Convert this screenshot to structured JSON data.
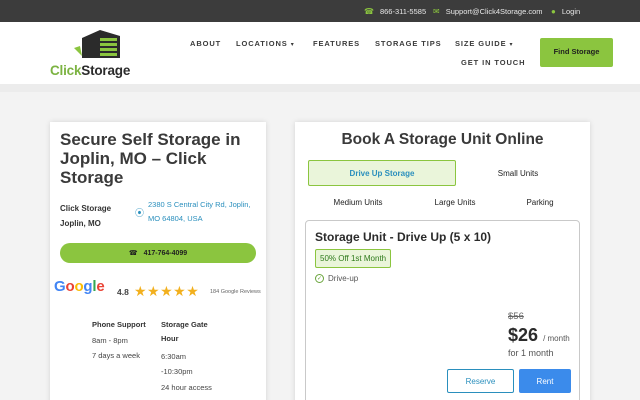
{
  "topbar": {
    "phone": "866-311-5585",
    "email": "Support@Click4Storage.com",
    "login": "Login",
    "phone_icon": "phone-icon",
    "email_icon": "envelope-icon",
    "login_icon": "user-icon"
  },
  "header": {
    "logo_word_1": "Click",
    "logo_word_2": "Storage",
    "nav": [
      {
        "label": "ABOUT"
      },
      {
        "label": "LOCATIONS",
        "caret": "▾"
      },
      {
        "label": "FEATURES"
      },
      {
        "label": "STORAGE TIPS"
      },
      {
        "label": "SIZE GUIDE",
        "caret": "▾"
      },
      {
        "label": "GET IN TOUCH"
      }
    ],
    "find_button": "Find Storage"
  },
  "location": {
    "title": "Secure Self Storage in Joplin, MO – Click Storage",
    "name": "Click Storage Joplin, MO",
    "address": "2380 S Central City Rd, Joplin, MO 64804, USA",
    "call_label": "417-764-4099",
    "google": {
      "g1": "G",
      "o1": "o",
      "o2": "o",
      "g2": "g",
      "l": "l",
      "e": "e"
    },
    "rating": "4.8",
    "stars": "★★★★★",
    "reviews": "184 Google Reviews",
    "hours": {
      "phone_support_heading": "Phone Support",
      "phone_support_lines": [
        "8am - 8pm",
        "7 days a week"
      ],
      "gate_heading": "Storage Gate Hour",
      "gate_lines": [
        "6:30am",
        "-10:30pm",
        "24 hour access"
      ]
    }
  },
  "booking": {
    "title": "Book A Storage Unit Online",
    "tabs": [
      "Drive Up Storage",
      "Small Units",
      "Medium Units",
      "Large Units",
      "Parking"
    ],
    "active_tab": "Drive Up Storage",
    "unit": {
      "title": "Storage Unit - Drive Up (5 x 10)",
      "promo": "50% Off 1st Month",
      "feature": "Drive-up",
      "old_price": "$56",
      "price": "$26",
      "price_suffix": "/ month",
      "price_note": "for 1 month",
      "reserve_label": "Reserve",
      "rent_label": "Rent"
    }
  },
  "colors": {
    "brand_green": "#8bc53f",
    "link_blue": "#2a8fbd",
    "rent_blue": "#3b8beb",
    "topbar_bg": "#3c3c3c"
  }
}
